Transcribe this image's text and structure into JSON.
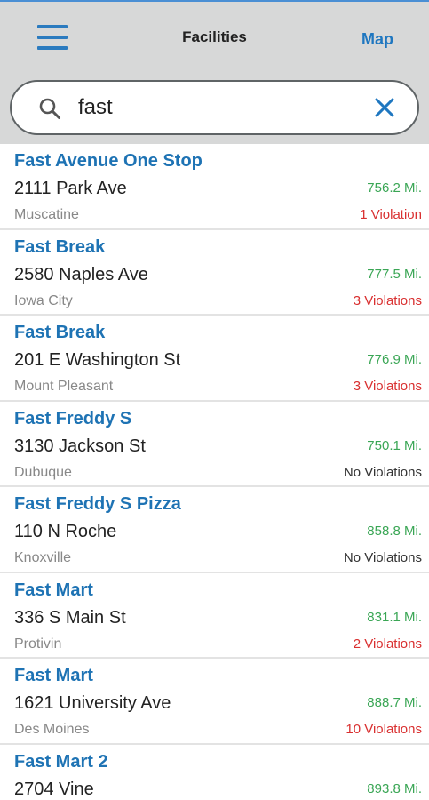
{
  "header": {
    "title": "Facilities",
    "map_label": "Map",
    "accent_color": "#1f77c0"
  },
  "search": {
    "value": "fast",
    "placeholder": ""
  },
  "facilities": [
    {
      "name": "Fast Avenue One Stop",
      "address": "2111 Park Ave",
      "city": "Muscatine",
      "distance": "756.2 Mi.",
      "violations": "1 Violation",
      "status": "bad"
    },
    {
      "name": "Fast Break",
      "address": "2580 Naples Ave",
      "city": "Iowa City",
      "distance": "777.5 Mi.",
      "violations": "3 Violations",
      "status": "bad"
    },
    {
      "name": "Fast Break",
      "address": "201 E Washington St",
      "city": "Mount Pleasant",
      "distance": "776.9 Mi.",
      "violations": "3 Violations",
      "status": "bad"
    },
    {
      "name": "Fast Freddy S",
      "address": "3130 Jackson St",
      "city": "Dubuque",
      "distance": "750.1 Mi.",
      "violations": "No Violations",
      "status": "none"
    },
    {
      "name": "Fast Freddy S Pizza",
      "address": "110 N Roche",
      "city": "Knoxville",
      "distance": "858.8 Mi.",
      "violations": "No Violations",
      "status": "none"
    },
    {
      "name": "Fast Mart",
      "address": "336 S Main St",
      "city": "Protivin",
      "distance": "831.1 Mi.",
      "violations": "2 Violations",
      "status": "bad"
    },
    {
      "name": "Fast Mart",
      "address": "1621 University Ave",
      "city": "Des Moines",
      "distance": "888.7 Mi.",
      "violations": "10 Violations",
      "status": "bad"
    },
    {
      "name": "Fast Mart 2",
      "address": "2704 Vine",
      "city": "",
      "distance": "893.8 Mi.",
      "violations": "",
      "status": "bad"
    }
  ]
}
